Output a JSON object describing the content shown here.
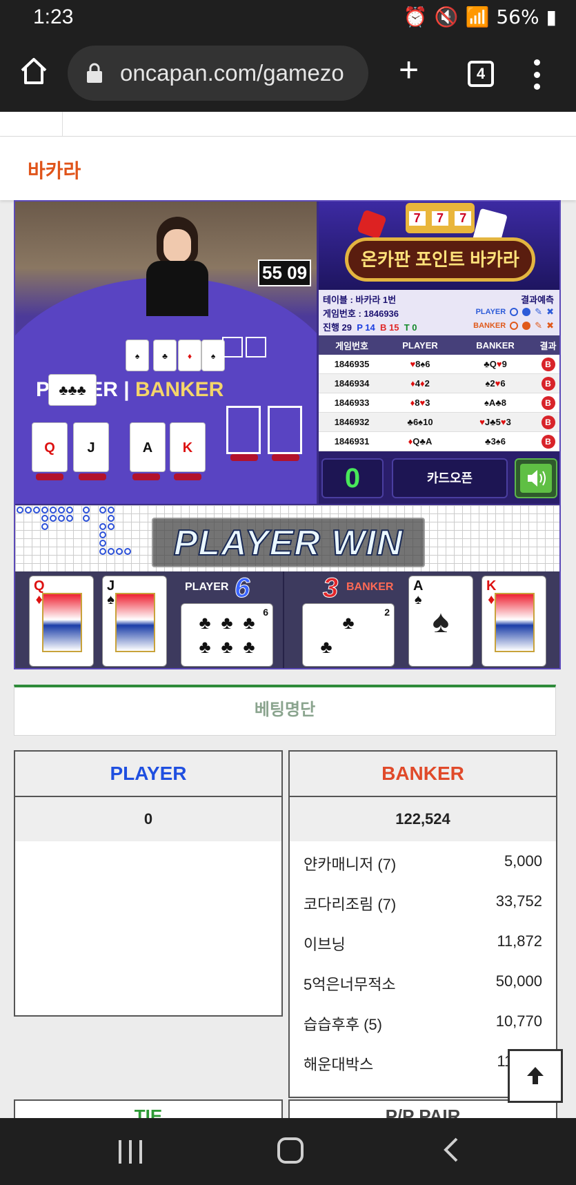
{
  "status_bar": {
    "time": "1:23",
    "battery": "56%"
  },
  "browser": {
    "url": "oncapan.com/gamezo",
    "tab_count": "4"
  },
  "page": {
    "title": "바카라"
  },
  "video": {
    "timer": "55 09",
    "overlay_player": "PLAYER",
    "overlay_banker": "BANKER"
  },
  "panel": {
    "banner_title": "온카판 포인트 바카라",
    "slot_digits": [
      "7",
      "7",
      "7"
    ],
    "table_label": "테이블 : 바카라 1번",
    "game_no_label": "게임번호 : 1846936",
    "progress_label": "진행 29",
    "p_count": "P 14",
    "b_count": "B 15",
    "t_count": "T 0",
    "prediction_label": "결과예측",
    "pred_player": "PLAYER",
    "pred_banker": "BANKER"
  },
  "history": {
    "headers": [
      "게임번호",
      "PLAYER",
      "BANKER",
      "결과"
    ],
    "rows": [
      {
        "no": "1846935",
        "player": "♥8♠6",
        "banker": "♣Q♥9",
        "result": "B"
      },
      {
        "no": "1846934",
        "player": "♦4♦2",
        "banker": "♠2♥6",
        "result": "B"
      },
      {
        "no": "1846933",
        "player": "♦8♥3",
        "banker": "♠A♣8",
        "result": "B"
      },
      {
        "no": "1846932",
        "player": "♣6♠10",
        "banker": "♥J♣5♥3",
        "result": "B"
      },
      {
        "no": "1846931",
        "player": "♦Q♣A",
        "banker": "♣3♠6",
        "result": "B"
      }
    ]
  },
  "controls": {
    "counter": "0",
    "open_label": "카드오픈",
    "sound_icon": "speaker-icon"
  },
  "result": {
    "banner": "PLAYER WIN",
    "player_label": "PLAYER",
    "player_score": "6",
    "banker_label": "BANKER",
    "banker_score": "3",
    "player_cards": [
      {
        "rank": "Q",
        "suit": "♦",
        "color": "red"
      },
      {
        "rank": "J",
        "suit": "♠",
        "color": "black"
      }
    ],
    "player_third": {
      "rank": "6",
      "suit": "♣"
    },
    "banker_third": {
      "rank": "2",
      "suit": "♣"
    },
    "banker_cards": [
      {
        "rank": "A",
        "suit": "♠",
        "color": "black"
      },
      {
        "rank": "K",
        "suit": "♦",
        "color": "red"
      }
    ]
  },
  "betting": {
    "title": "베팅명단",
    "player": {
      "header": "PLAYER",
      "total": "0"
    },
    "banker": {
      "header": "BANKER",
      "total": "122,524",
      "rows": [
        {
          "name": "얀카매니저 (7)",
          "amount": "5,000"
        },
        {
          "name": "코다리조림 (7)",
          "amount": "33,752"
        },
        {
          "name": "이브닝",
          "amount": "11,872"
        },
        {
          "name": "5억은너무적소",
          "amount": "50,000"
        },
        {
          "name": "습습후후 (5)",
          "amount": "10,770"
        },
        {
          "name": "해운대박스",
          "amount": "11,130"
        }
      ]
    },
    "next_headers": [
      "TIE",
      "P/P PAIR"
    ]
  },
  "colors": {
    "accent_orange": "#e0541a",
    "player_blue": "#1f4fe0",
    "banker_red": "#e04a2a",
    "tie_green": "#2e9a36"
  }
}
